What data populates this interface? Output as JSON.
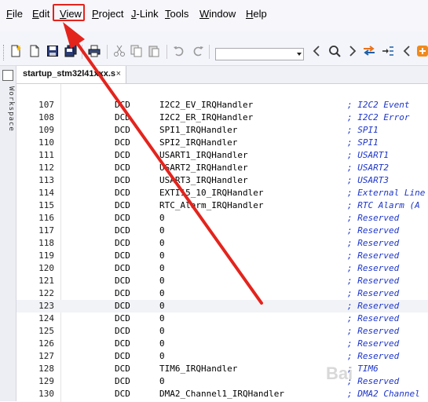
{
  "menubar": {
    "items": [
      "File",
      "Edit",
      "View",
      "Project",
      "J-Link",
      "Tools",
      "Window",
      "Help"
    ]
  },
  "toolbar": {
    "icons": [
      "new-file-icon",
      "open-file-icon",
      "save-icon",
      "save-all-icon",
      "print-icon",
      "cut-icon",
      "copy-icon",
      "paste-icon",
      "undo-icon",
      "redo-icon",
      "find-combo",
      "back-icon",
      "search-icon",
      "forward-icon",
      "toggle-bookmark-icon",
      "goto-icon",
      "previous-icon",
      "add-icon"
    ],
    "find_value": ""
  },
  "side_panel": {
    "label": "Workspace"
  },
  "editor": {
    "tab_label": "startup_stm32l41xxx.s",
    "tab_close": "×",
    "current_line": 123,
    "lines": [
      {
        "n": "107",
        "kw": "DCD",
        "op": "I2C2_EV_IRQHandler",
        "cm": "; I2C2 Event"
      },
      {
        "n": "108",
        "kw": "DCD",
        "op": "I2C2_ER_IRQHandler",
        "cm": "; I2C2 Error"
      },
      {
        "n": "109",
        "kw": "DCD",
        "op": "SPI1_IRQHandler",
        "cm": "; SPI1"
      },
      {
        "n": "110",
        "kw": "DCD",
        "op": "SPI2_IRQHandler",
        "cm": "; SPI1"
      },
      {
        "n": "111",
        "kw": "DCD",
        "op": "USART1_IRQHandler",
        "cm": "; USART1"
      },
      {
        "n": "112",
        "kw": "DCD",
        "op": "USART2_IRQHandler",
        "cm": "; USART2"
      },
      {
        "n": "113",
        "kw": "DCD",
        "op": "USART3_IRQHandler",
        "cm": "; USART3"
      },
      {
        "n": "114",
        "kw": "DCD",
        "op": "EXTI15_10_IRQHandler",
        "cm": "; External Line"
      },
      {
        "n": "115",
        "kw": "DCD",
        "op": "RTC_Alarm_IRQHandler",
        "cm": "; RTC Alarm (A"
      },
      {
        "n": "116",
        "kw": "DCD",
        "op": "0",
        "cm": "; Reserved"
      },
      {
        "n": "117",
        "kw": "DCD",
        "op": "0",
        "cm": "; Reserved"
      },
      {
        "n": "118",
        "kw": "DCD",
        "op": "0",
        "cm": "; Reserved"
      },
      {
        "n": "119",
        "kw": "DCD",
        "op": "0",
        "cm": "; Reserved"
      },
      {
        "n": "120",
        "kw": "DCD",
        "op": "0",
        "cm": "; Reserved"
      },
      {
        "n": "121",
        "kw": "DCD",
        "op": "0",
        "cm": "; Reserved"
      },
      {
        "n": "122",
        "kw": "DCD",
        "op": "0",
        "cm": "; Reserved"
      },
      {
        "n": "123",
        "kw": "DCD",
        "op": "0",
        "cm": "; Reserved"
      },
      {
        "n": "124",
        "kw": "DCD",
        "op": "0",
        "cm": "; Reserved"
      },
      {
        "n": "125",
        "kw": "DCD",
        "op": "0",
        "cm": "; Reserved"
      },
      {
        "n": "126",
        "kw": "DCD",
        "op": "0",
        "cm": "; Reserved"
      },
      {
        "n": "127",
        "kw": "DCD",
        "op": "0",
        "cm": "; Reserved"
      },
      {
        "n": "128",
        "kw": "DCD",
        "op": "TIM6_IRQHandler",
        "cm": "; TIM6"
      },
      {
        "n": "129",
        "kw": "DCD",
        "op": "0",
        "cm": "; Reserved"
      },
      {
        "n": "130",
        "kw": "DCD",
        "op": "DMA2_Channel1_IRQHandler",
        "cm": "; DMA2 Channel"
      }
    ]
  },
  "annotation": {
    "color": "#e3241d"
  },
  "watermark": "Bai"
}
